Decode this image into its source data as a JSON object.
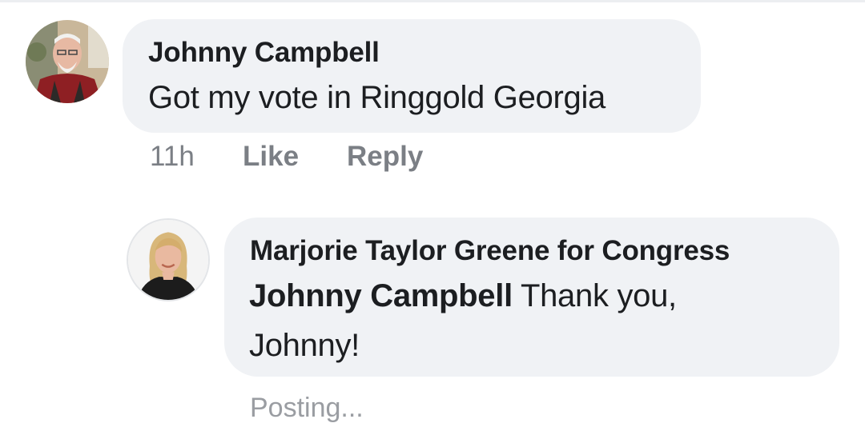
{
  "comment": {
    "author": "Johnny Campbell",
    "text": "Got my vote in Ringgold Georgia",
    "time": "11h",
    "like_label": "Like",
    "reply_label": "Reply",
    "avatar_icon": "user-avatar-older-man"
  },
  "reply": {
    "author": "Marjorie Taylor Greene for Congress",
    "mention": "Johnny Campbell",
    "text_line1": " Thank you,",
    "text_line2": "Johnny!",
    "status": "Posting...",
    "avatar_icon": "user-avatar-woman"
  },
  "colors": {
    "bubble_bg": "#f0f2f5",
    "primary_text": "#1c1e21",
    "secondary_text": "#7b7f85"
  }
}
